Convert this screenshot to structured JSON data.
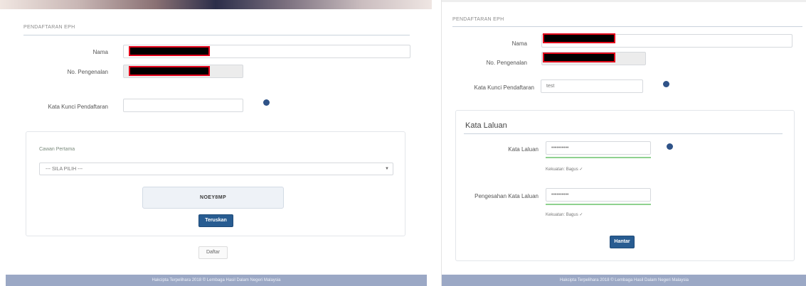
{
  "left": {
    "section_title": "PENDAFTARAN EPH",
    "fields": {
      "nama_label": "Nama",
      "no_pengenalan_label": "No. Pengenalan",
      "kata_kunci_label": "Kata Kunci Pendaftaran"
    },
    "cawangan": {
      "label": "Cawan Pertama",
      "select_value": "--- SILA PILIH ---"
    },
    "captcha_text": "NOEY8MP",
    "teruskan_label": "Teruskan",
    "daftar_label": "Daftar",
    "footer_text": "Hakcipta Terpelihara 2018 © Lembaga Hasil Dalam Negeri Malaysia"
  },
  "right": {
    "section_title": "PENDAFTARAN EPH",
    "fields": {
      "nama_label": "Nama",
      "no_pengenalan_label": "No. Pengenalan",
      "kata_kunci_label": "Kata Kunci Pendaftaran",
      "kata_kunci_value": "test"
    },
    "kata_laluan": {
      "heading": "Kata Laluan",
      "password_label": "Kata Laluan",
      "password_value": "••••••••••",
      "password_strength": "Kekuatan: Bagus ✓",
      "confirm_label": "Pengesahan Kata Laluan",
      "confirm_value": "••••••••••",
      "confirm_strength": "Kekuatan: Bagus ✓"
    },
    "hantar_label": "Hantar",
    "footer_text": "Hakcipta Terpelihara 2018 © Lembaga Hasil Dalam Negeri Malaysia"
  },
  "colors": {
    "accent_button": "#285c91",
    "redaction_border": "#e2001a",
    "strength_bar": "#8fd18f",
    "footer": "#9ba8c5"
  }
}
